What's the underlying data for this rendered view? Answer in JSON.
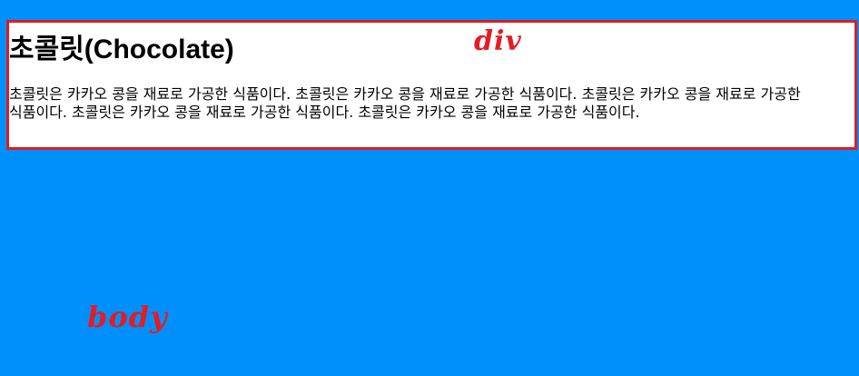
{
  "div": {
    "heading": "초콜릿(Chocolate)",
    "paragraph": "초콜릿은 카카오 콩을 재료로 가공한 식품이다. 초콜릿은 카카오 콩을 재료로 가공한 식품이다. 초콜릿은 카카오 콩을 재료로 가공한 식품이다. 초콜릿은 카카오 콩을 재료로 가공한 식품이다. 초콜릿은 카카오 콩을 재료로 가공한 식품이다."
  },
  "annotations": {
    "div_label": "div",
    "body_label": "body"
  },
  "colors": {
    "body_background": "#0090fe",
    "div_background": "#ffffff",
    "div_border": "#e21b1b",
    "annotation": "#e41c23"
  }
}
